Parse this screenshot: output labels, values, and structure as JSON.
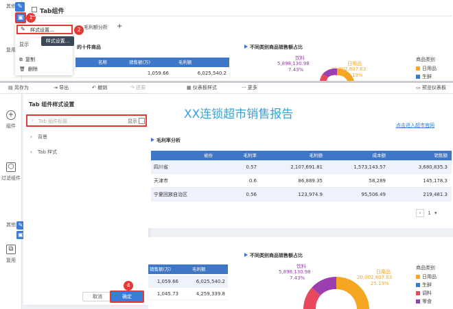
{
  "top": {
    "sidebar_other": "其他",
    "sidebar_copy": "复用",
    "component_title": "Tab组件",
    "tab_label": "毛利额分析",
    "add_tab": "+",
    "menu": {
      "style_settings": "样式设置...",
      "tooltip": "样式设置...",
      "show_partial": "显示",
      "copy": "复制",
      "delete": "删除"
    },
    "table_title_partial": "的十件商品",
    "table_headers": [
      "名称",
      "销售额(万)",
      "毛利额"
    ],
    "table_rows": [
      {
        "name": "",
        "sales": "1,059.66",
        "profit": "6,025,540.2"
      }
    ],
    "pie_title": "不同类别商品销售额占比",
    "pie_labels": [
      {
        "name": "饮料",
        "value": "5,898,130.98",
        "pct": "7.43%"
      },
      {
        "name": "日用品",
        "value": "20,002,807.63",
        "pct": "25.19%"
      }
    ],
    "legend_title": "商品类别",
    "legend_items": [
      {
        "label": "日用品",
        "color": "#f5a623"
      },
      {
        "label": "生鲜",
        "color": "#2d7fd3"
      }
    ]
  },
  "toolbar": {
    "save_as": "另存为",
    "export": "导出",
    "undo": "撤销",
    "redo": "还原",
    "dashboard_style": "仪表板样式",
    "more": "更多",
    "preview": "预览仪表板"
  },
  "left_sidebar": {
    "component": "组件",
    "filter_component": "过滤组件",
    "other": "其他",
    "copy": "复用"
  },
  "settings": {
    "title": "Tab 组件样式设置",
    "tab_title_item": "Tab 组件标题",
    "show_label": "显示",
    "background": "背景",
    "tab_style": "Tab 样式",
    "cancel": "取消",
    "confirm": "确定"
  },
  "badges": [
    "1",
    "2",
    "3",
    "4"
  ],
  "report": {
    "title": "XX连锁超市销售报告",
    "link": "点击进入超市官网",
    "margin_title": "毛利率分析",
    "headers": [
      "省份",
      "毛利率",
      "毛利额",
      "成本额",
      "销售额"
    ],
    "rows": [
      {
        "province": "四川省",
        "rate": "0.57",
        "profit": "2,107,691.81",
        "cost": "1,573,143.57",
        "sales": "3,680,835.3"
      },
      {
        "province": "天津市",
        "rate": "0.6",
        "profit": "86,889.35",
        "cost": "58,289",
        "sales": "145,178.3"
      },
      {
        "province": "宁夏回族自治区",
        "rate": "0.56",
        "profit": "123,974.9",
        "cost": "95,506.49",
        "sales": "219,481.3"
      }
    ],
    "page": "1"
  },
  "bottom": {
    "pie_title": "不同类别商品销售额占比",
    "headers": [
      "销售额(万)",
      "毛利额"
    ],
    "rows": [
      {
        "sales": "1,059.66",
        "profit": "6,025,540.2"
      },
      {
        "sales": "1,045.73",
        "profit": "4,259,339.8"
      }
    ],
    "pie_labels": [
      {
        "name": "饮料",
        "value": "5,898,130.98",
        "pct": "7.43%"
      },
      {
        "name": "日用品",
        "value": "20,002,807.63",
        "pct": "25.19%"
      }
    ],
    "legend_title": "商品类别",
    "legend_items": [
      {
        "label": "日用品",
        "color": "#f5a623"
      },
      {
        "label": "生鲜",
        "color": "#2d7fd3"
      },
      {
        "label": "调料",
        "color": "#e8485c"
      },
      {
        "label": "零食",
        "color": "#8e44ad"
      }
    ]
  }
}
